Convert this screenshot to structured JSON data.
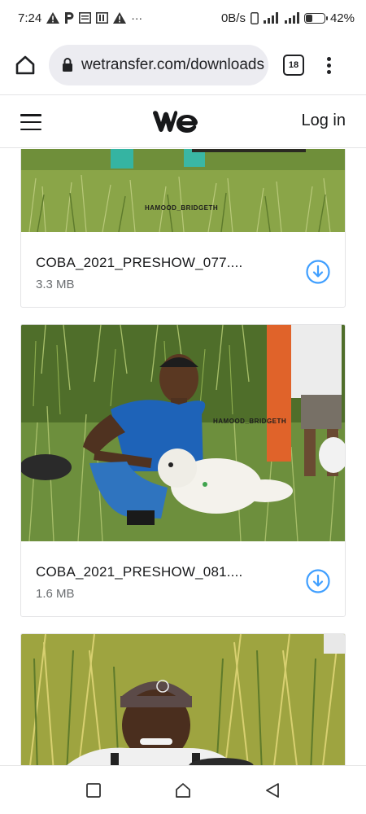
{
  "status_bar": {
    "time": "7:24",
    "left_icons": [
      "warning-icon",
      "parking-icon",
      "message-icon",
      "sim-icon",
      "warning-icon"
    ],
    "more": "···",
    "network_speed": "0B/s",
    "battery_percent": "42%",
    "battery_level": 0.42
  },
  "browser": {
    "url": "wetransfer.com/downloads",
    "tab_count": "18"
  },
  "header": {
    "logo": "we",
    "login_label": "Log in"
  },
  "files": [
    {
      "name": "COBA_2021_PRESHOW_077....",
      "size": "3.3 MB",
      "watermark": "HAMOOD_BRIDGETH"
    },
    {
      "name": "COBA_2021_PRESHOW_081....",
      "size": "1.6 MB",
      "watermark": "HAMOOD_BRIDGETH"
    },
    {
      "name": "",
      "size": "",
      "watermark": ""
    }
  ],
  "colors": {
    "accent": "#409fff",
    "grass": "#6f8f3a",
    "border": "#e4e4e6"
  }
}
